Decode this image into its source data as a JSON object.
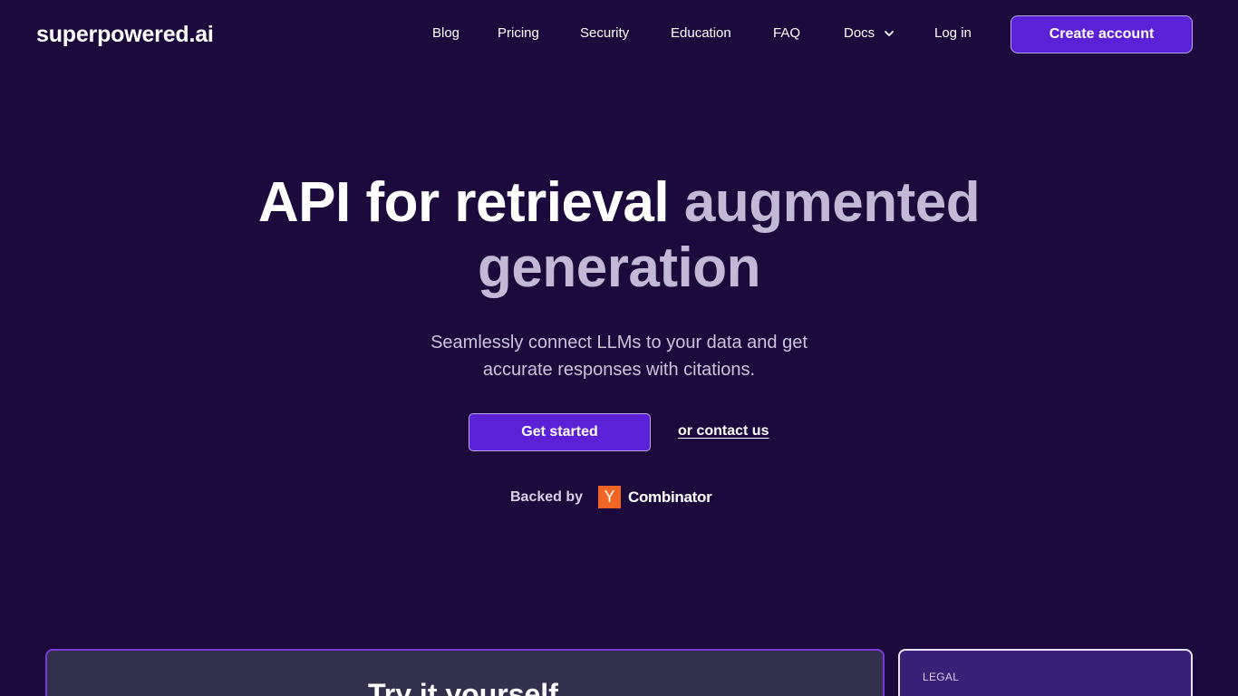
{
  "brand": {
    "logo_text": "superpowered.ai"
  },
  "nav": {
    "blog": "Blog",
    "pricing": "Pricing",
    "security": "Security",
    "education": "Education",
    "faq": "FAQ",
    "docs": "Docs",
    "login": "Log in",
    "create_account": "Create account"
  },
  "hero": {
    "title_part1": "API for retrieval",
    "title_part2": "augmented",
    "title_part3": "generation",
    "subtitle_line1": "Seamlessly connect LLMs to your data and get",
    "subtitle_line2": "accurate responses with citations.",
    "cta_primary": "Get started",
    "cta_secondary": "or contact us",
    "backed_by": "Backed by",
    "yc_letter": "Y",
    "yc_name": "Combinator"
  },
  "cards": {
    "try_title": "Try it yourself",
    "legal_label": "LEGAL"
  },
  "colors": {
    "background": "#1c0a3c",
    "accent": "#5b21d6",
    "yc_orange": "#f26625"
  },
  "icons": {
    "docs_dropdown": "chevron-down-icon"
  }
}
